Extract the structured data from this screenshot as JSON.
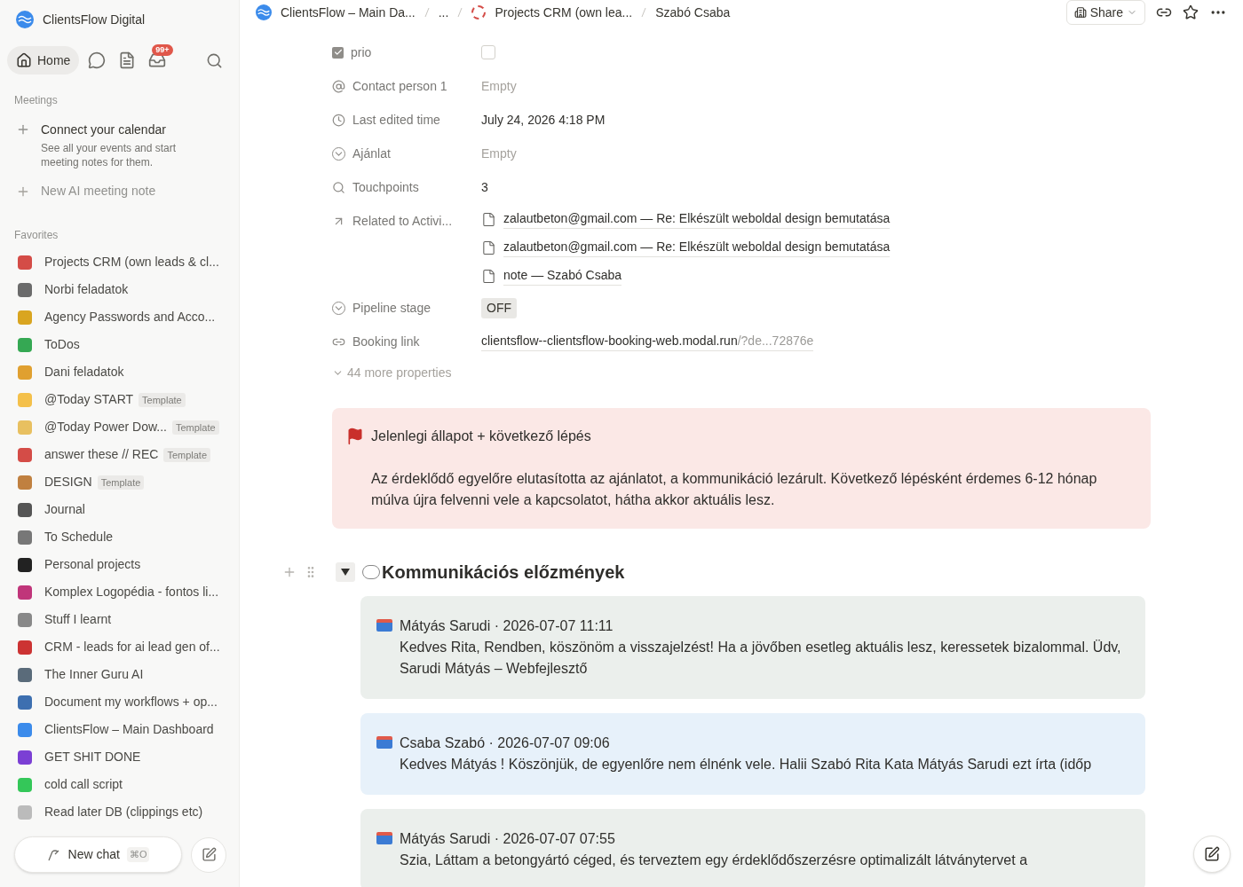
{
  "workspace": {
    "name": "ClientsFlow Digital"
  },
  "nav": {
    "home": "Home",
    "inbox_badge": "99+"
  },
  "meetings": {
    "title": "Meetings",
    "connect_title": "Connect your calendar",
    "connect_desc": "See all your events and start meeting notes for them.",
    "new_note": "New AI meeting note"
  },
  "favorites": {
    "title": "Favorites",
    "items": [
      {
        "label": "Projects CRM (own leads & cl..."
      },
      {
        "label": "Norbi feladatok"
      },
      {
        "label": "Agency Passwords and Acco..."
      },
      {
        "label": "ToDos"
      },
      {
        "label": "Dani feladatok"
      },
      {
        "label": "@Today START",
        "badge": "Template"
      },
      {
        "label": "@Today Power Dow...",
        "badge": "Template"
      },
      {
        "label": "answer these // REC",
        "badge": "Template"
      },
      {
        "label": "DESIGN",
        "badge": "Template"
      },
      {
        "label": "Journal"
      },
      {
        "label": "To Schedule"
      },
      {
        "label": "Personal projects"
      },
      {
        "label": "Komplex Logopédia - fontos li..."
      },
      {
        "label": "Stuff I learnt"
      },
      {
        "label": "CRM - leads for ai lead gen of..."
      },
      {
        "label": "The Inner Guru AI"
      },
      {
        "label": "Document my workflows + op..."
      },
      {
        "label": "ClientsFlow – Main Dashboard"
      },
      {
        "label": "GET SHIT DONE"
      },
      {
        "label": "cold call script"
      },
      {
        "label": "Read later DB (clippings etc)"
      }
    ]
  },
  "new_chat": {
    "label": "New chat",
    "shortcut": "⌘O"
  },
  "breadcrumbs": [
    "ClientsFlow – Main Da...",
    "...",
    "Projects CRM (own lea...",
    "Szabó Csaba"
  ],
  "topbar": {
    "share": "Share"
  },
  "properties": [
    {
      "kind": "checkbox",
      "label": "prio",
      "checked": false
    },
    {
      "kind": "empty",
      "label": "Contact person 1",
      "value": "Empty"
    },
    {
      "kind": "text",
      "label": "Last edited time",
      "value": "July 24, 2026 4:18 PM"
    },
    {
      "kind": "empty",
      "label": "Ajánlat",
      "value": "Empty"
    },
    {
      "kind": "text",
      "label": "Touchpoints",
      "value": "3"
    },
    {
      "kind": "relations",
      "label": "Related to Activi...",
      "items": [
        "zalautbeton@gmail.com — Re: Elkészült weboldal design bemutatása",
        "zalautbeton@gmail.com — Re: Elkészült weboldal design bemutatása",
        "note — Szabó Csaba"
      ]
    },
    {
      "kind": "tag",
      "label": "Pipeline stage",
      "value": "OFF"
    },
    {
      "kind": "link",
      "label": "Booking link",
      "value": "clientsflow--clientsflow-booking-web.modal.run",
      "suffix": "/?de...72876e"
    }
  ],
  "more_properties": "44 more properties",
  "callout": {
    "title": "Jelenlegi állapot + következő lépés",
    "body": "Az érdeklődő egyelőre elutasította az ajánlatot, a kommunikáció lezárult. Következő lépésként érdemes 6-12 hónap múlva újra felvenni vele a kapcsolatot, hátha akkor aktuális lesz."
  },
  "section": {
    "title": "Kommunikációs előzmények",
    "expanded": true
  },
  "messages": [
    {
      "kind": "sent",
      "header": "Mátyás Sarudi · 2026-07-07 11:11",
      "body": "Kedves Rita, Rendben, köszönöm a visszajelzést! Ha a jövőben esetleg aktuális lesz, keressetek bizalommal. Üdv, Sarudi Mátyás – Webfejlesztő"
    },
    {
      "kind": "received",
      "header": "Csaba Szabó · 2026-07-07 09:06",
      "body": "Kedves Mátyás ! Köszönjük, de egyenlőre nem élnénk vele. Halii Szabó Rita Kata Mátyás Sarudi ezt írta (időp"
    },
    {
      "kind": "sent",
      "header": "Mátyás Sarudi · 2026-07-07 07:55",
      "body": "Szia, Láttam a betongyártó céged, és terveztem egy érdeklődőszerzésre optimalizált látványtervet a"
    }
  ]
}
